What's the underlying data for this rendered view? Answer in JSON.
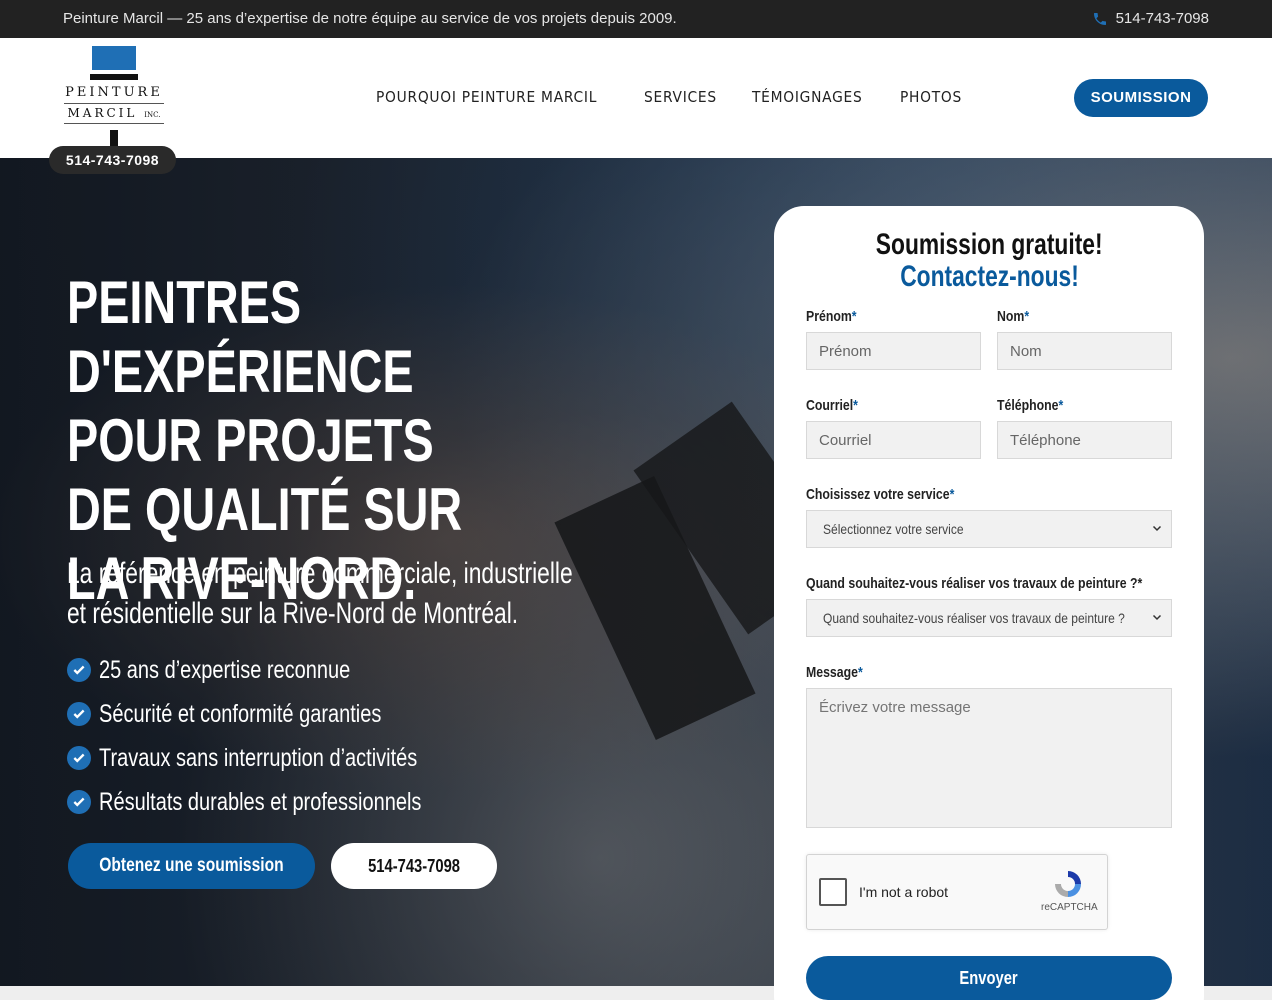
{
  "topbar": {
    "tagline": "Peinture Marcil — 25 ans d’expertise de notre équipe au service de vos projets depuis 2009.",
    "phone": "514-743-7098"
  },
  "logo": {
    "line1": "PEINTURE",
    "line2": "MARCIL",
    "suffix": "INC.",
    "phone": "514-743-7098"
  },
  "nav": {
    "items": [
      "POURQUOI PEINTURE MARCIL",
      "SERVICES",
      "TÉMOIGNAGES",
      "PHOTOS"
    ],
    "cta": "SOUMISSION"
  },
  "hero": {
    "title": "Peintres d'expérience pour projets de qualité sur la Rive-Nord.",
    "subtitle": "La référence en peinture commerciale, industrielle et résidentielle sur la Rive-Nord de Montréal.",
    "checks": [
      "25 ans d’expertise reconnue",
      "Sécurité et conformité garanties",
      "Travaux sans interruption d’activités",
      "Résultats durables et professionnels"
    ],
    "cta_primary": "Obtenez une soumission",
    "cta_secondary": "514-743-7098"
  },
  "form": {
    "title_line1": "Soumission gratuite!",
    "title_line2": "Contactez-nous!",
    "prenom_label": "Prénom",
    "prenom_placeholder": "Prénom",
    "nom_label": "Nom",
    "nom_placeholder": "Nom",
    "courriel_label": "Courriel",
    "courriel_placeholder": "Courriel",
    "telephone_label": "Téléphone",
    "telephone_placeholder": "Téléphone",
    "service_label": "Choisissez votre service",
    "service_selected": "Sélectionnez votre service",
    "quand_label": "Quand souhaitez-vous réaliser vos travaux de peinture ?*",
    "quand_selected": "Quand souhaitez-vous réaliser vos travaux de peinture ?",
    "message_label": "Message",
    "message_placeholder": "Écrivez votre message",
    "required_mark": "*",
    "captcha_label": "I'm not a robot",
    "captcha_brand": "reCAPTCHA",
    "submit": "Envoyer"
  },
  "colors": {
    "brand_blue": "#0a5a9c",
    "topbar_bg": "#222222",
    "check_blue": "#1f6fb5"
  }
}
